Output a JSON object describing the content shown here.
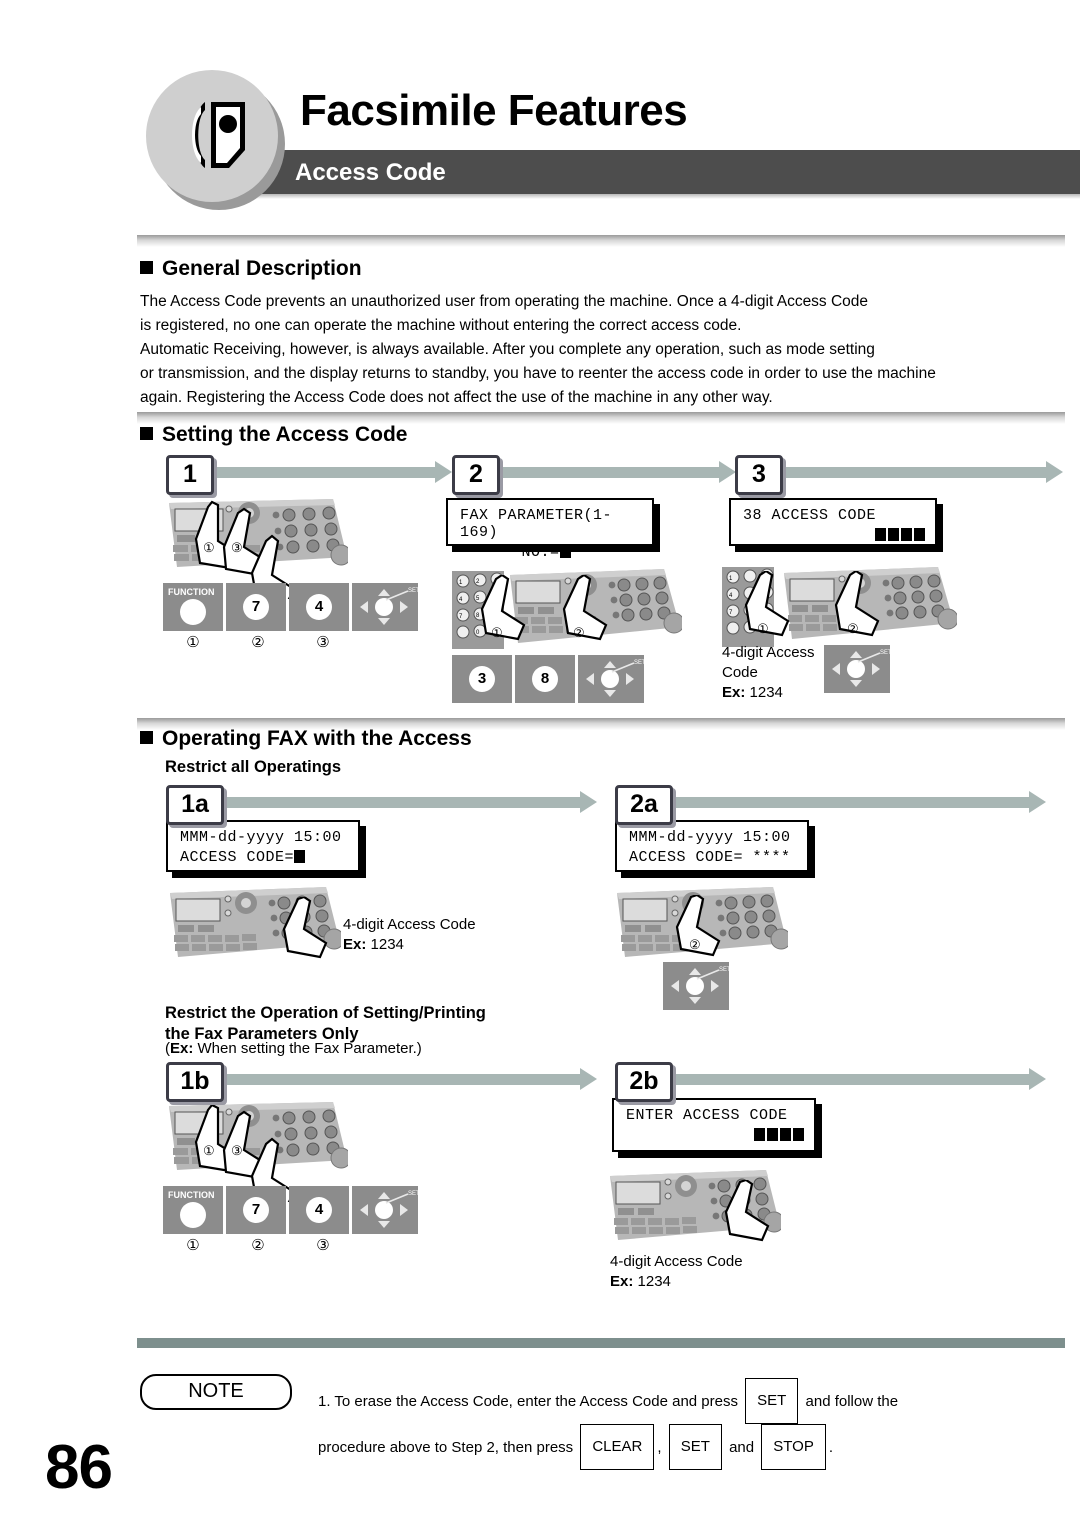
{
  "header": {
    "icon_name": "fax-machine-icon",
    "title": "Facsimile Features",
    "subtitle": "Access Code",
    "bar_color": "#4d4d4d"
  },
  "sections": {
    "general": {
      "heading": "General Description",
      "paragraph": "The Access Code prevents an unauthorized user from operating the machine. Once a 4-digit Access Code\nis registered, no one can operate the machine without entering the correct access code.\nAutomatic Receiving, however, is always available. After you complete any operation, such as mode setting\nor transmission, and the display returns to standby, you have to reenter the access code in order to use the machine\nagain. Registering the Access Code does not affect the use of the machine in any other way."
    },
    "setting": {
      "heading": "Setting the Access Code",
      "steps": [
        {
          "label": "1",
          "keycaps": [
            {
              "label": "FUNCTION",
              "value": "",
              "num": "①"
            },
            {
              "label": "",
              "value": "7",
              "num": "②"
            },
            {
              "label": "",
              "value": "4",
              "num": ""
            },
            {
              "label": "",
              "value": "nav",
              "num": "③"
            }
          ],
          "panel_markers": [
            "①",
            "②",
            "③"
          ]
        },
        {
          "label": "2",
          "lcd_line1": "FAX  PARAMETER(1-169)",
          "lcd_line2": "NO.=",
          "keycaps": [
            {
              "value": "3"
            },
            {
              "value": "8"
            },
            {
              "value": "nav"
            }
          ],
          "panel_markers": [
            "①",
            "②"
          ]
        },
        {
          "label": "3",
          "lcd_line1": "38 ACCESS CODE",
          "lcd_blocks": 4,
          "caption_l1": "4-digit Access",
          "caption_l2": "Code",
          "caption_ex_label": "Ex:",
          "caption_ex_value": "1234",
          "panel_markers": [
            "①",
            "②"
          ]
        }
      ]
    },
    "operating": {
      "heading": "Operating FAX with the Access",
      "sub_a": {
        "title": "Restrict all Operatings",
        "steps": [
          {
            "label": "1a",
            "lcd_line1": "MMM-dd-yyyy 15:00",
            "lcd_line2": "ACCESS CODE=",
            "caption_l1": "4-digit Access Code",
            "caption_ex_label": "Ex:",
            "caption_ex_value": "1234"
          },
          {
            "label": "2a",
            "lcd_line1": "MMM-dd-yyyy 15:00",
            "lcd_line2": "ACCESS CODE= ****",
            "panel_markers": [
              "②"
            ]
          }
        ]
      },
      "sub_b": {
        "title": "Restrict the Operation of Setting/Printing\nthe Fax Parameters Only",
        "note_prefix": "(",
        "note_ex_label": "Ex:",
        "note_text": " When setting the Fax Parameter.)",
        "steps": [
          {
            "label": "1b",
            "keycaps": [
              {
                "label": "FUNCTION",
                "value": "",
                "num": "①"
              },
              {
                "label": "",
                "value": "7",
                "num": "②"
              },
              {
                "label": "",
                "value": "4",
                "num": ""
              },
              {
                "label": "",
                "value": "nav",
                "num": "③"
              }
            ],
            "panel_markers": [
              "①",
              "②",
              "③"
            ]
          },
          {
            "label": "2b",
            "lcd_line1": "ENTER ACCESS CODE",
            "lcd_blocks": 4,
            "caption_l1": "4-digit Access Code",
            "caption_ex_label": "Ex:",
            "caption_ex_value": "1234"
          }
        ]
      }
    }
  },
  "footer": {
    "note_label": "NOTE",
    "note_line1_a": "1. To erase the Access Code, enter the Access Code and press",
    "note_line1_key": "SET",
    "note_line1_b": "and follow the",
    "note_line2_a": "procedure above to Step 2, then press",
    "note_line2_key1": "CLEAR",
    "note_line2_sep": ",",
    "note_line2_key2": "SET",
    "note_line2_and": "and",
    "note_line2_key3": "STOP",
    "note_line2_end": ".",
    "page_number": "86",
    "rule_color": "#7d8f8d"
  }
}
